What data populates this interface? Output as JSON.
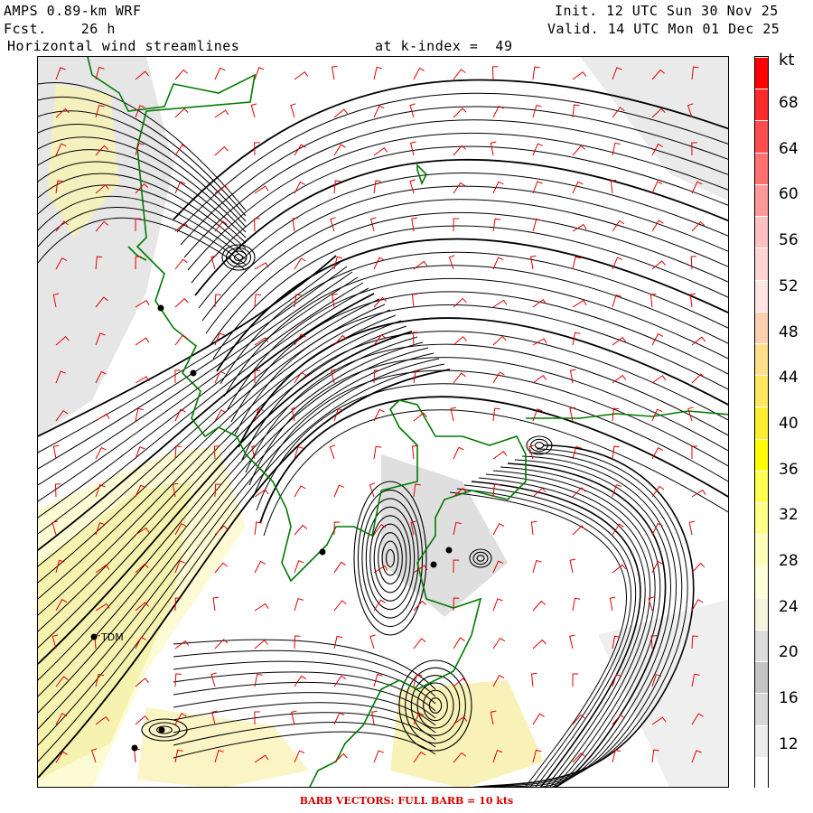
{
  "header": {
    "model": "AMPS 0.89-km WRF",
    "fcst": "Fcst.    26 h",
    "product": "Horizontal wind streamlines",
    "level": "at k-index =  49",
    "init": "Init. 12 UTC Sun 30 Nov 25",
    "valid": "Valid. 14 UTC Mon 01 Dec 25"
  },
  "colorbar": {
    "unit": "kt",
    "tick_labels": [
      "68",
      "64",
      "60",
      "56",
      "52",
      "48",
      "44",
      "40",
      "36",
      "32",
      "28",
      "24",
      "20",
      "16",
      "12"
    ],
    "colors": [
      "#ff0000",
      "#ff2a2a",
      "#ff4c4c",
      "#ff7070",
      "#ff9a9a",
      "#ffc0c0",
      "#ffd4d4",
      "#ffe4e4",
      "#ffd0b0",
      "#ffe08a",
      "#ffe860",
      "#ffee30",
      "#ffff00",
      "#ffff50",
      "#ffff88",
      "#ffffb8",
      "#ffffd8",
      "#f4f4dc",
      "#dcdcdc",
      "#c4c4c4",
      "#d8d8d8",
      "#ececec",
      "#ffffff"
    ]
  },
  "stations": [
    {
      "label": "TDM"
    }
  ],
  "footer": "BARB VECTORS:  FULL BARB = 10 kts",
  "colors": {
    "streamline": "#000000",
    "barb": "#e00000",
    "coastline": "#007a00"
  }
}
